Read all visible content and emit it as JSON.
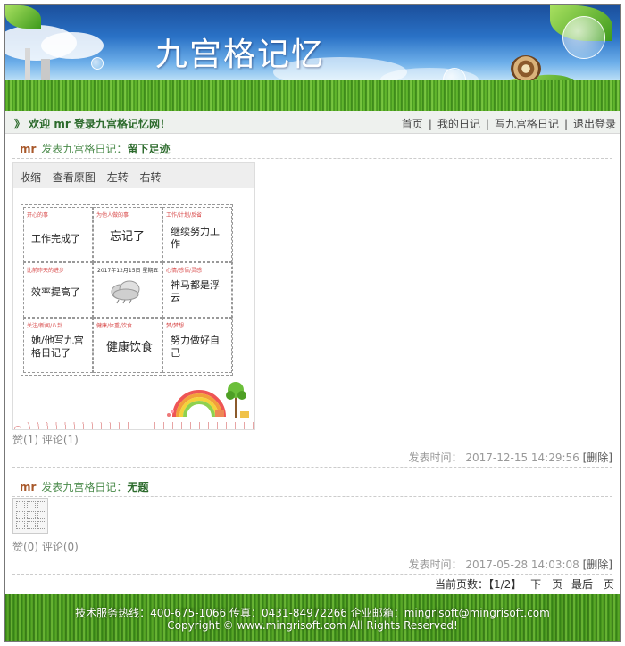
{
  "banner": {
    "title": "九宫格记忆"
  },
  "welcome": {
    "message": "》 欢迎 mr 登录九宫格记忆网！",
    "nav": [
      "首页",
      "我的日记",
      "写九宫格日记",
      "退出登录"
    ]
  },
  "posts": [
    {
      "user": "mr",
      "label": "发表九宫格日记：",
      "title": "留下足迹",
      "toolbar": [
        "收缩",
        "查看原图",
        "左转",
        "右转"
      ],
      "grid": [
        {
          "category": "开心的事",
          "text": "工作完成了"
        },
        {
          "category": "为他人做的事",
          "text": "忘记了"
        },
        {
          "category": "工作/计划/反省",
          "text": "继续努力工作"
        },
        {
          "category": "比前昨天的进步",
          "text": "效率提高了"
        },
        {
          "date": "2017年12月15日 星期五",
          "icon": "rain-cloud-icon"
        },
        {
          "category": "心情/感悟/灵感",
          "text": "神马都是浮云"
        },
        {
          "category": "关注/新闻/八卦",
          "text": "她/他写九宫格日记了"
        },
        {
          "category": "健康/体重/饮食",
          "text": "健康饮食"
        },
        {
          "category": "梦/梦想",
          "text": "努力做好自己"
        }
      ],
      "stats": "赞(1) 评论(1)",
      "time_label": "发表时间：",
      "time": "2017-12-15 14:29:56",
      "delete": "[删除]"
    },
    {
      "user": "mr",
      "label": "发表九宫格日记：",
      "title": "无题",
      "stats": "赞(0) 评论(0)",
      "time_label": "发表时间：",
      "time": "2017-05-28 14:03:08",
      "delete": "[删除]"
    }
  ],
  "pager": {
    "current_label": "当前页数：",
    "current": "【1/2】",
    "next": "下一页",
    "last": "最后一页"
  },
  "footer": {
    "line1": "技术服务热线：400-675-1066 传真：0431-84972266 企业邮箱：mingrisoft@mingrisoft.com",
    "line2": "Copyright © www.mingrisoft.com All Rights Reserved!"
  },
  "colors": {
    "accent_green": "#2d6b2d",
    "user_brown": "#a8582a",
    "category_red": "#d84a4a"
  }
}
